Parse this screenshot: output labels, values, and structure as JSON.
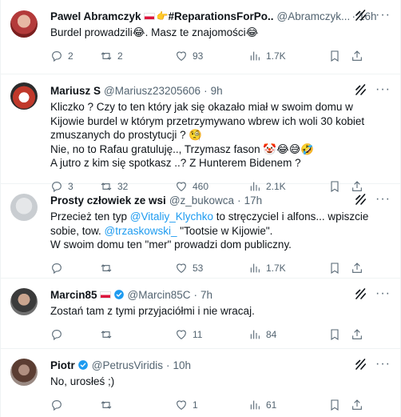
{
  "tweets": [
    {
      "name": "Pawel Abramczyk",
      "name_suffix": "#ReparationsForPo...",
      "handle": "@Abramczyk...",
      "time": "16h",
      "text": "Burdel prowadzili😂. Masz te znajomości😂",
      "replies": "2",
      "retweets": "2",
      "likes": "93",
      "views": "1.7K"
    },
    {
      "name": "Mariusz S",
      "handle": "@Mariusz23205606",
      "time": "9h",
      "text": "Kliczko ? Czy to ten który jak się okazało miał w swoim domu w Kijowie burdel w którym przetrzymywano wbrew ich woli 30 kobiet zmuszanych do prostytucji ? 🧐\nNie, no to Rafau gratuluję.., Trzymasz fason 🤡😂😅🤣\nA jutro z kim się spotkasz ..? Z Hunterem Bidenem ?",
      "replies": "3",
      "retweets": "32",
      "likes": "460",
      "views": "2.1K"
    },
    {
      "name": "Prosty człowiek ze wsi",
      "handle": "@z_bukowca",
      "time": "17h",
      "text_parts": {
        "p1": "Przecież ten typ ",
        "m1": "@Vitaliy_Klychko",
        "p2": "  to stręczyciel i alfons... wpiszcie sobie, tow. ",
        "m2": "@trzaskowski_",
        "p3": "  \"Tootsie w Kijowie\".\nW swoim domu ten \"mer\" prowadzi dom publiczny."
      },
      "replies": "",
      "retweets": "",
      "likes": "53",
      "views": "1.7K"
    },
    {
      "name": "Marcin85",
      "handle": "@Marcin85C",
      "time": "7h",
      "text": "Zostań tam z tymi przyjaciółmi i nie wracaj.",
      "replies": "",
      "retweets": "",
      "likes": "11",
      "views": "84"
    },
    {
      "name": "Piotr",
      "handle": "@PetrusViridis",
      "time": "10h",
      "text": "No, urosłeś ;)",
      "replies": "",
      "retweets": "",
      "likes": "1",
      "views": "61"
    }
  ],
  "separator": "·",
  "colors": {
    "accent": "#1d9bf0",
    "muted": "#536471",
    "text": "#0f1419",
    "divider": "#eff3f4"
  },
  "icons": [
    "reply-icon",
    "retweet-icon",
    "like-icon",
    "views-icon",
    "bookmark-icon",
    "share-icon",
    "grok-icon",
    "more-icon",
    "verified-badge-icon",
    "flag-pl-icon",
    "pointing-hand-icon"
  ]
}
